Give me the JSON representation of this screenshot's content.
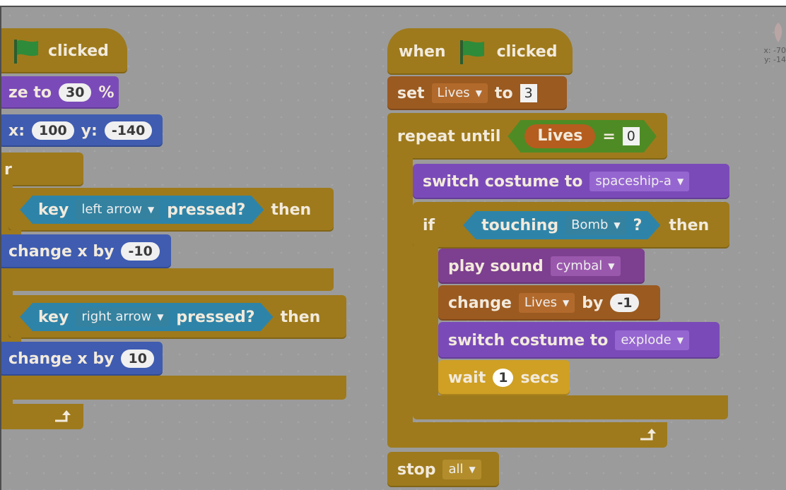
{
  "left_script": {
    "hat_clicked": "clicked",
    "size_prefix": "ze to",
    "size_value": "30",
    "size_unit": "%",
    "goto_x_label": "x:",
    "goto_x": "100",
    "goto_y_label": "y:",
    "goto_y": "-140",
    "forever_fragment": "r",
    "if1_key_label": "key",
    "if1_key_value": "left arrow",
    "if1_pressed": "pressed?",
    "if1_then": "then",
    "change1_label": "change x by",
    "change1_value": "-10",
    "if2_key_label": "key",
    "if2_key_value": "right arrow",
    "if2_pressed": "pressed?",
    "if2_then": "then",
    "change2_label": "change x by",
    "change2_value": "10"
  },
  "right_script": {
    "when_label": "when",
    "clicked_label": "clicked",
    "set_label": "set",
    "set_var": "Lives",
    "set_to": "to",
    "set_value": "3",
    "repeat_label": "repeat until",
    "repeat_var": "Lives",
    "repeat_eq": "=",
    "repeat_value": "0",
    "costume1_label": "switch costume to",
    "costume1_value": "spaceship-a",
    "if_label": "if",
    "touching_label": "touching",
    "touching_value": "Bomb",
    "touching_q": "?",
    "if_then": "then",
    "play_label": "play sound",
    "play_value": "cymbal",
    "change_label": "change",
    "change_var": "Lives",
    "change_by": "by",
    "change_value": "-1",
    "costume2_label": "switch costume to",
    "costume2_value": "explode",
    "wait_label": "wait",
    "wait_value": "1",
    "wait_unit": "secs",
    "stop_label": "stop",
    "stop_value": "all"
  },
  "sprite_info": {
    "x_label": "x: -70",
    "y_label": "y: -14"
  },
  "colors": {
    "control": "#9e7a1c",
    "variables": "#9b5a20",
    "looks": "#7a4bb8",
    "sound": "#7d3f8f",
    "motion": "#3f5cb0",
    "sensing": "#2e84a8",
    "operators": "#4e8b25",
    "wait_control": "#cfa024",
    "flag": "#2e8b3a"
  },
  "icons": {
    "hat_flag": "green-flag-icon",
    "loop_arrow": "loop-arrow-icon",
    "dropdown": "dropdown-triangle-icon"
  }
}
